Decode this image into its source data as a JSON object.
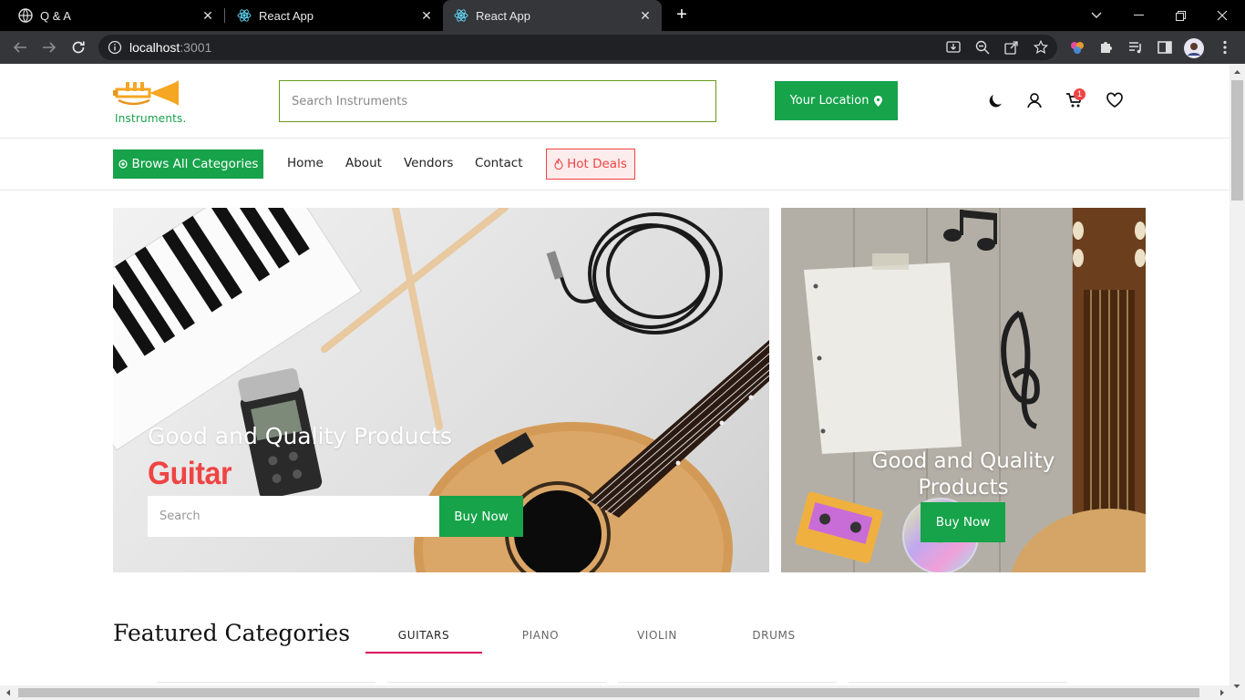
{
  "browser": {
    "tabs": [
      {
        "title": "Q & A",
        "icon": "globe-icon",
        "active": false
      },
      {
        "title": "React App",
        "icon": "react-icon",
        "active": false
      },
      {
        "title": "React App",
        "icon": "react-icon",
        "active": true
      }
    ],
    "url_host": "localhost",
    "url_port": ":3001"
  },
  "header": {
    "logo_text": "Instruments.",
    "search_placeholder": "Search Instruments",
    "location_button": "Your Location",
    "cart_count": "1"
  },
  "nav": {
    "browse_label": "Brows All Categories",
    "links": [
      "Home",
      "About",
      "Vendors",
      "Contact"
    ],
    "hot_deals": "Hot Deals"
  },
  "hero": {
    "title": "Good and Quality Products",
    "subtitle": "Guitar",
    "search_placeholder": "Search",
    "buy_label": "Buy Now"
  },
  "side_banner": {
    "title": "Good and Quality Products",
    "buy_label": "Buy Now"
  },
  "featured": {
    "title": "Featured Categories",
    "tabs": [
      "GUITARS",
      "PIANO",
      "VIOLIN",
      "DRUMS"
    ],
    "active_tab": "GUITARS"
  },
  "colors": {
    "primary_green": "#16a34a",
    "accent_red": "#ef4444",
    "tab_underline": "#d9005b"
  }
}
